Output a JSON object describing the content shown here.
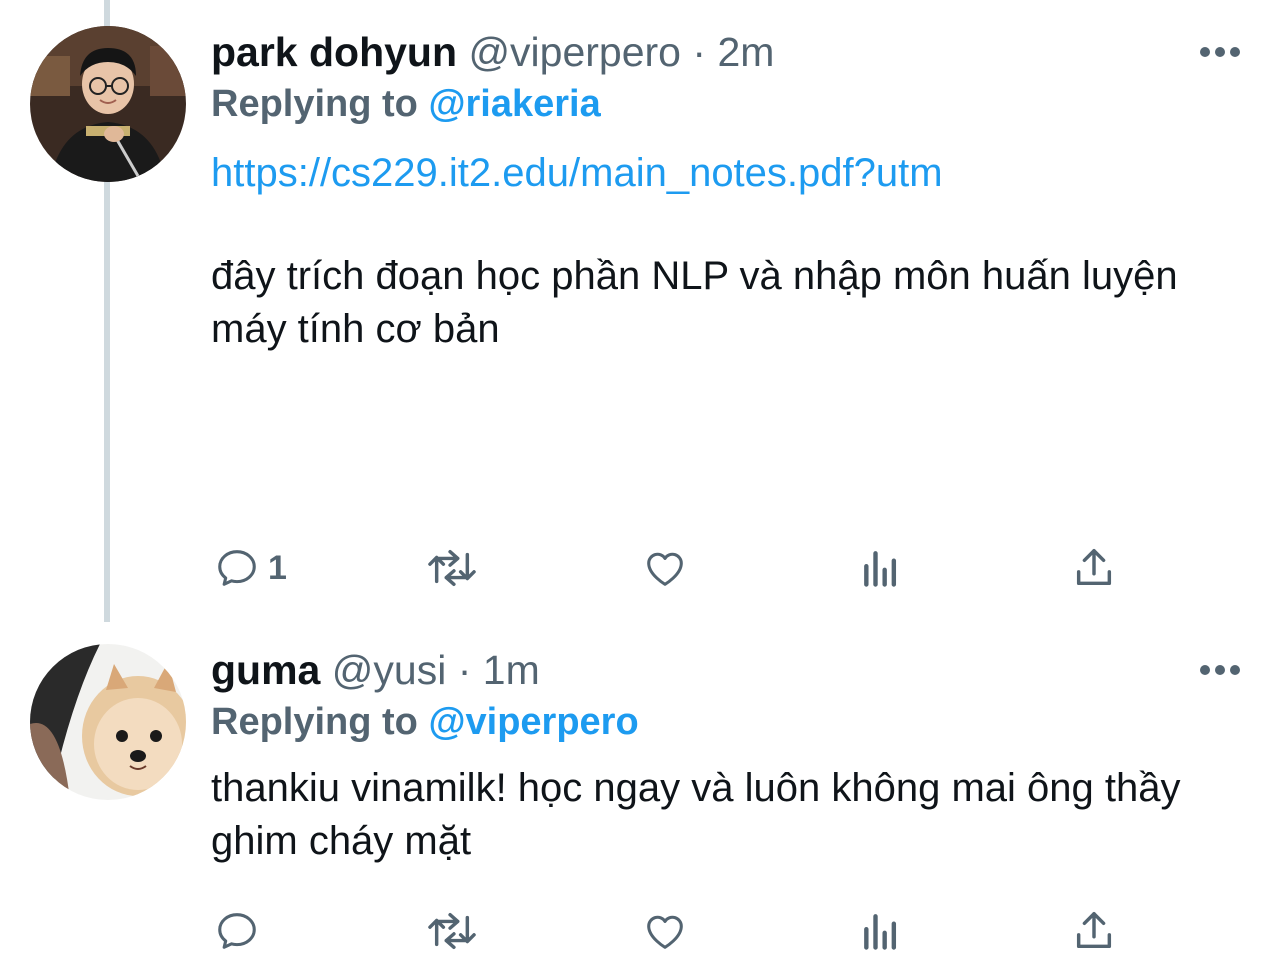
{
  "tweets": [
    {
      "name": "park dohyun",
      "handle": "@viperpero",
      "separator": "·",
      "time": "2m",
      "replying_prefix": "Replying to ",
      "replying_to": "@riakeria",
      "link": "https://cs229.it2.edu/main_notes.pdf?utm",
      "text": "đây trích đoạn học phần NLP và nhập môn huấn luyện máy tính cơ bản",
      "reply_count": "1",
      "icons": [
        "reply-icon",
        "retweet-icon",
        "like-icon",
        "views-icon",
        "share-icon",
        "more-icon"
      ]
    },
    {
      "name": "guma",
      "handle": "@yusi",
      "separator": "·",
      "time": "1m",
      "replying_prefix": "Replying to ",
      "replying_to": "@viperpero",
      "text": "thankiu vinamilk! học ngay và luôn không mai ông thầy ghim cháy mặt",
      "reply_count": "",
      "icons": [
        "reply-icon",
        "retweet-icon",
        "like-icon",
        "views-icon",
        "share-icon",
        "more-icon"
      ]
    }
  ],
  "colors": {
    "text": "#0f1419",
    "secondary": "#536471",
    "accent": "#1d9bf0",
    "thread_line": "#cfd9de"
  }
}
